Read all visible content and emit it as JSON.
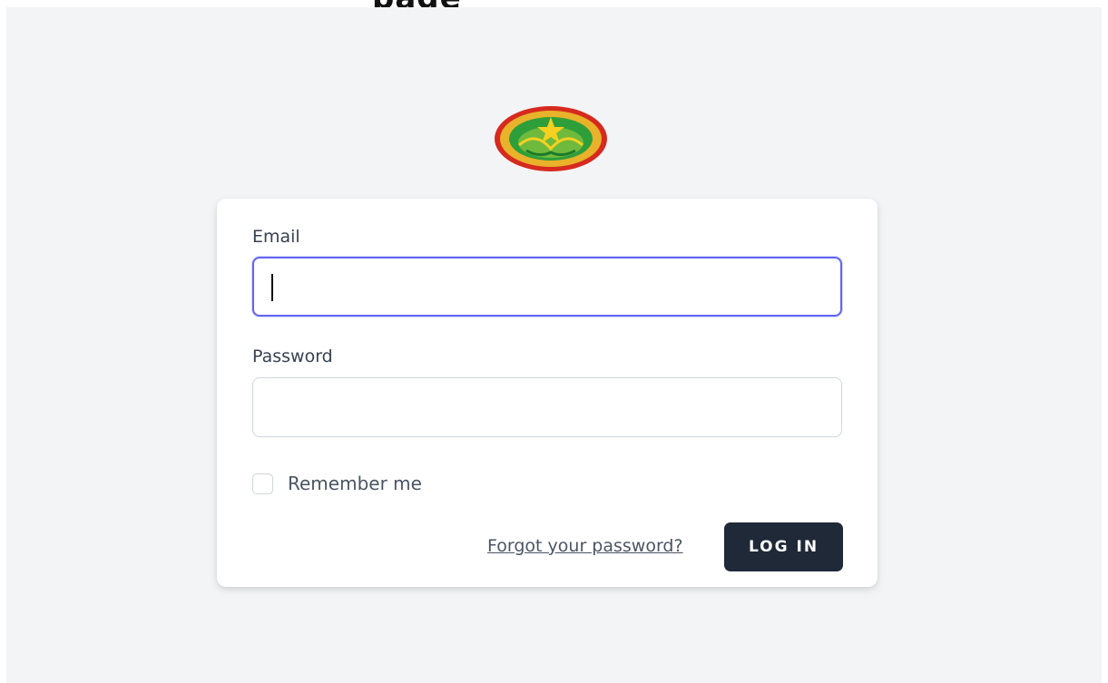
{
  "header": {
    "partial_title": "page"
  },
  "logo": {
    "icon": "emblem-seal-icon",
    "colors": {
      "ring": "#d62a1f",
      "inner": "#2e9e3a",
      "star": "#f5d020"
    }
  },
  "form": {
    "email_label": "Email",
    "email_value": "",
    "password_label": "Password",
    "password_value": "",
    "remember_label": "Remember me",
    "remember_checked": false,
    "forgot_link": "Forgot your password?",
    "login_button": "LOG IN"
  },
  "colors": {
    "background": "#f3f4f6",
    "card": "#ffffff",
    "focus": "#6366f1",
    "button": "#1f2937"
  }
}
